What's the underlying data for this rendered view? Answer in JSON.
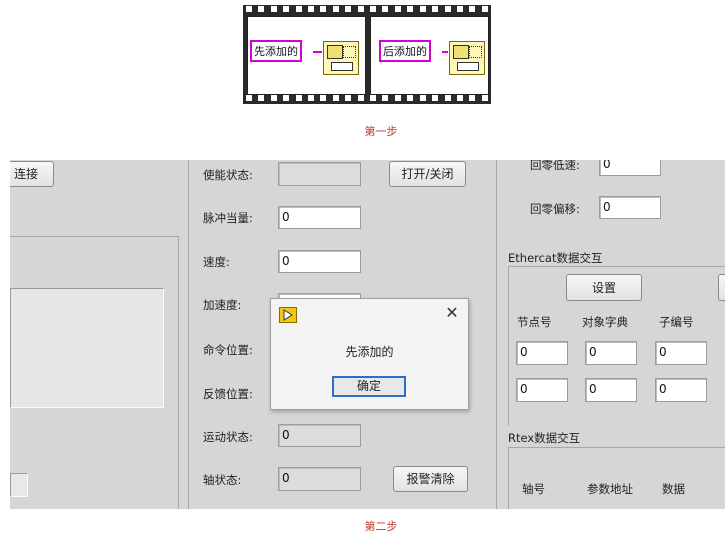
{
  "step1": {
    "caption": "第一步",
    "frame1_label": "先添加的",
    "frame2_label": "后添加的"
  },
  "step2": {
    "caption": "第二步"
  },
  "panel": {
    "connect_button": "连接",
    "labels": {
      "enable_state": "使能状态:",
      "pulse_equiv": "脉冲当量:",
      "speed": "速度:",
      "accel": "加速度:",
      "cmd_pos": "命令位置:",
      "fb_pos": "反馈位置:",
      "motion_state": "运动状态:",
      "axis_state": "轴状态:",
      "home_low_speed": "回零低速:",
      "home_offset": "回零偏移:"
    },
    "values": {
      "pulse_equiv": "0",
      "speed": "0",
      "motion_state": "0",
      "axis_state": "0",
      "home_low_speed": "0",
      "home_offset": "0"
    },
    "buttons": {
      "open_close": "打开/关闭",
      "alarm_clear": "报警清除",
      "settings": "设置"
    },
    "ethercat": {
      "title": "Ethercat数据交互",
      "col_node": "节点号",
      "col_dict": "对象字典",
      "col_sub": "子编号",
      "row1": [
        "0",
        "0",
        "0"
      ],
      "row2": [
        "0",
        "0",
        "0"
      ]
    },
    "rtex": {
      "title": "Rtex数据交互",
      "col_axis": "轴号",
      "col_param": "参数地址",
      "col_data": "数据"
    }
  },
  "dialog": {
    "message": "先添加的",
    "ok_label": "确定"
  },
  "colors": {
    "wire_pink": "#d400d4",
    "caption_red": "#c0392b",
    "panel_grey": "#d6d6d6",
    "focus_blue": "#2b6fc9",
    "labview_icon": "#f5c518"
  }
}
